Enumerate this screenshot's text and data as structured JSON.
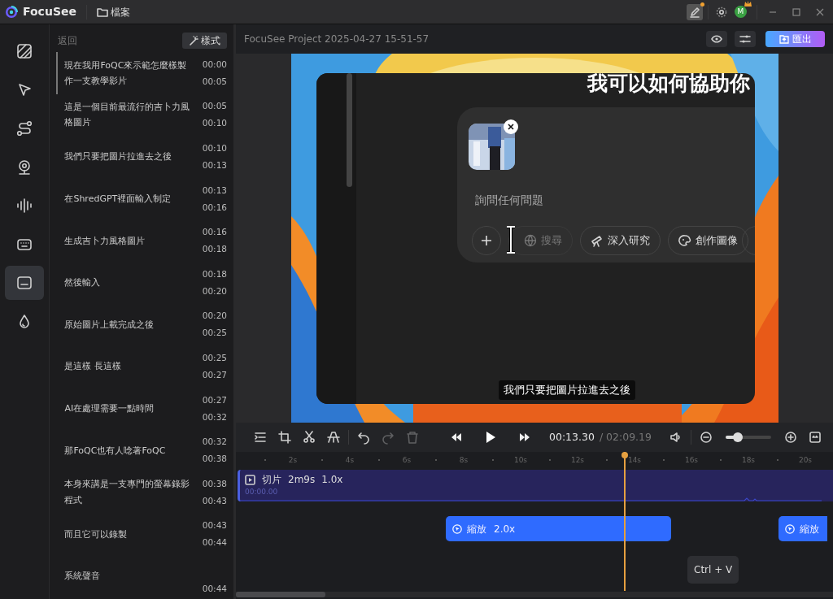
{
  "app": {
    "name": "FocuSee",
    "menu": "檔案",
    "user_initial": "M"
  },
  "rail": [
    {
      "kind": "background",
      "selected": false
    },
    {
      "kind": "cursor",
      "selected": false
    },
    {
      "kind": "path",
      "selected": false
    },
    {
      "kind": "camera",
      "selected": false
    },
    {
      "kind": "audio",
      "selected": false
    },
    {
      "kind": "keyboard",
      "selected": false
    },
    {
      "kind": "captions",
      "selected": true
    },
    {
      "kind": "effects",
      "selected": false
    }
  ],
  "subtitles": {
    "back": "返回",
    "style_button": "樣式",
    "items": [
      {
        "text": "現在我用FoQC來示範怎麼樣製作一支教學影片",
        "start": "00:00",
        "end": "00:05",
        "selected": true
      },
      {
        "text": "這是一個目前最流行的吉卜力風格圖片",
        "start": "00:05",
        "end": "00:10",
        "selected": false
      },
      {
        "text": "我們只要把圖片拉進去之後",
        "start": "00:10",
        "end": "00:13",
        "selected": false
      },
      {
        "text": "在ShredGPT裡面輸入制定",
        "start": "00:13",
        "end": "00:16",
        "selected": false
      },
      {
        "text": "生成吉卜力風格圖片",
        "start": "00:16",
        "end": "00:18",
        "selected": false
      },
      {
        "text": "然後輸入",
        "start": "00:18",
        "end": "00:20",
        "selected": false
      },
      {
        "text": "原始圖片上載完成之後",
        "start": "00:20",
        "end": "00:25",
        "selected": false
      },
      {
        "text": "是這樣 長這樣",
        "start": "00:25",
        "end": "00:27",
        "selected": false
      },
      {
        "text": "AI在處理需要一點時間",
        "start": "00:27",
        "end": "00:32",
        "selected": false
      },
      {
        "text": "那FoQC也有人唸著FoQC",
        "start": "00:32",
        "end": "00:38",
        "selected": false
      },
      {
        "text": "本身來講是一支專門的螢幕錄影程式",
        "start": "00:38",
        "end": "00:43",
        "selected": false
      },
      {
        "text": "而且它可以錄製",
        "start": "00:43",
        "end": "00:44",
        "selected": false
      },
      {
        "text": "系統聲音",
        "start": "00:44",
        "selected": false
      }
    ]
  },
  "project": {
    "title": "FocuSee Project 2025-04-27 15-51-57",
    "export": "匯出"
  },
  "preview": {
    "heading": "我可以如何協助你",
    "placeholder": "詢問任何問題",
    "chips": [
      {
        "kind": "plus"
      },
      {
        "kind": "search",
        "label": "搜尋",
        "disabled": true
      },
      {
        "kind": "research",
        "label": "深入研究",
        "disabled": false
      },
      {
        "label": "創作圖像",
        "disabled": false
      }
    ],
    "caption": "我們只要把圖片拉進去之後"
  },
  "toolbar": {
    "tools": [
      {
        "kind": "split",
        "disabled": false
      },
      {
        "kind": "crop",
        "disabled": false
      },
      {
        "kind": "cut",
        "disabled": false
      },
      {
        "kind": "mask",
        "disabled": false
      },
      {
        "kind": "undo",
        "disabled": false
      },
      {
        "kind": "redo",
        "disabled": true
      },
      {
        "kind": "delete",
        "disabled": true
      }
    ],
    "current": "00:13.30",
    "total": "/ 02:09.19",
    "zoom": {
      "level": 0.27
    }
  },
  "timeline": {
    "ticks": [
      "2s",
      "4s",
      "6s",
      "8s",
      "10s",
      "12s",
      "14s",
      "16s",
      "18s",
      "20s"
    ],
    "clip": {
      "label": "切片",
      "duration": "2m9s",
      "speed": "1.0x",
      "start": "00:00.00"
    },
    "zoom_segments": [
      {
        "label": "縮放",
        "scale": "2.0x"
      },
      {
        "label": "縮放"
      }
    ],
    "tooltip": "Ctrl + V"
  }
}
